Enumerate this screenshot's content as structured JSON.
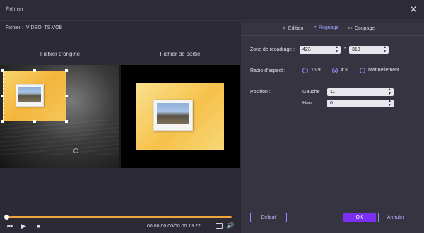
{
  "window": {
    "title": "Édition"
  },
  "file": {
    "label": "Fichier :",
    "name": "VIDEO_TS.VOB"
  },
  "preview": {
    "original_title": "Fichier d'origine",
    "output_title": "Fichier de sortie"
  },
  "playback": {
    "time": "00:00:00.00/00:00:19.22",
    "progress": 0.0
  },
  "tabs": [
    {
      "label": "Édition",
      "icon": "edit-sparkle-icon",
      "active": false
    },
    {
      "label": "Rognage",
      "icon": "crop-icon",
      "active": true
    },
    {
      "label": "Coupage",
      "icon": "scissors-icon",
      "active": false
    }
  ],
  "crop": {
    "zone_label": "Zone de recadrage :",
    "width": "423",
    "separator": "*",
    "height": "318",
    "ratio_label": "Radio d'aspect :",
    "ratio_options": [
      "16:9",
      "4:3",
      "Manuellement"
    ],
    "ratio_selected": "4:3",
    "position_label": "Position :",
    "left_label": "Gauche :",
    "left_value": "11",
    "top_label": "Haut :",
    "top_value": "0"
  },
  "buttons": {
    "default": "Défaut",
    "ok": "OK",
    "cancel": "Annuler"
  },
  "colors": {
    "accent": "#7b2ff2",
    "radio": "#8b8ff2",
    "progress": "#f0a53a"
  }
}
